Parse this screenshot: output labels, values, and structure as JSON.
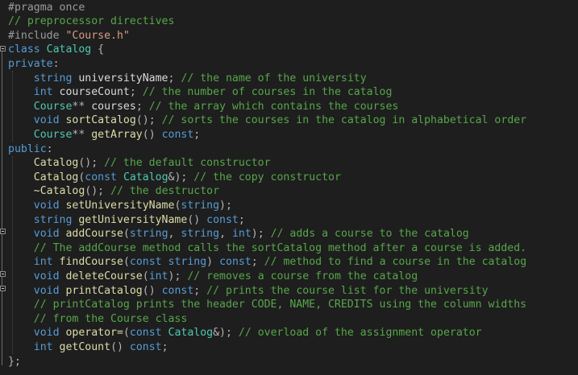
{
  "code": {
    "lines": [
      [
        [
          "pp",
          "#pragma once"
        ]
      ],
      [
        [
          "cm",
          "// preprocessor directives"
        ]
      ],
      [
        [
          "pp",
          "#include "
        ],
        [
          "str",
          "\"Course.h\""
        ]
      ],
      [
        [
          "kw",
          "class "
        ],
        [
          "typ",
          "Catalog"
        ],
        [
          "p",
          " {"
        ]
      ],
      [
        [
          "kw",
          "private"
        ],
        [
          "p",
          ":"
        ]
      ],
      [
        [
          "p",
          "    "
        ],
        [
          "kw",
          "string "
        ],
        [
          "var",
          "universityName"
        ],
        [
          "p",
          "; "
        ],
        [
          "cm",
          "// the name of the university"
        ]
      ],
      [
        [
          "p",
          "    "
        ],
        [
          "kw",
          "int "
        ],
        [
          "var",
          "courseCount"
        ],
        [
          "p",
          "; "
        ],
        [
          "cm",
          "// the number of courses in the catalog"
        ]
      ],
      [
        [
          "p",
          "    "
        ],
        [
          "typ",
          "Course"
        ],
        [
          "p",
          "** "
        ],
        [
          "var",
          "courses"
        ],
        [
          "p",
          "; "
        ],
        [
          "cm",
          "// the array which contains the courses"
        ]
      ],
      [
        [
          "p",
          "    "
        ],
        [
          "kw",
          "void "
        ],
        [
          "fn",
          "sortCatalog"
        ],
        [
          "p",
          "(); "
        ],
        [
          "cm",
          "// sorts the courses in the catalog in alphabetical order"
        ]
      ],
      [
        [
          "p",
          "    "
        ],
        [
          "typ",
          "Course"
        ],
        [
          "p",
          "** "
        ],
        [
          "fn",
          "getArray"
        ],
        [
          "p",
          "() "
        ],
        [
          "kw",
          "const"
        ],
        [
          "p",
          ";"
        ]
      ],
      [
        [
          "kw",
          "public"
        ],
        [
          "p",
          ":"
        ]
      ],
      [
        [
          "p",
          "    "
        ],
        [
          "fn",
          "Catalog"
        ],
        [
          "p",
          "(); "
        ],
        [
          "cm",
          "// the default constructor"
        ]
      ],
      [
        [
          "p",
          "    "
        ],
        [
          "fn",
          "Catalog"
        ],
        [
          "p",
          "("
        ],
        [
          "kw",
          "const "
        ],
        [
          "typ",
          "Catalog"
        ],
        [
          "p",
          "&); "
        ],
        [
          "cm",
          "// the copy constructor"
        ]
      ],
      [
        [
          "p",
          "    "
        ],
        [
          "fn",
          "~Catalog"
        ],
        [
          "p",
          "(); "
        ],
        [
          "cm",
          "// the destructor"
        ]
      ],
      [
        [
          "p",
          "    "
        ],
        [
          "kw",
          "void "
        ],
        [
          "fn",
          "setUniversityName"
        ],
        [
          "p",
          "("
        ],
        [
          "kw",
          "string"
        ],
        [
          "p",
          ");"
        ]
      ],
      [
        [
          "p",
          "    "
        ],
        [
          "kw",
          "string "
        ],
        [
          "fn",
          "getUniversityName"
        ],
        [
          "p",
          "() "
        ],
        [
          "kw",
          "const"
        ],
        [
          "p",
          ";"
        ]
      ],
      [
        [
          "p",
          "    "
        ],
        [
          "kw",
          "void "
        ],
        [
          "fn",
          "addCourse"
        ],
        [
          "p",
          "("
        ],
        [
          "kw",
          "string"
        ],
        [
          "p",
          ", "
        ],
        [
          "kw",
          "string"
        ],
        [
          "p",
          ", "
        ],
        [
          "kw",
          "int"
        ],
        [
          "p",
          "); "
        ],
        [
          "cm",
          "// adds a course to the catalog"
        ]
      ],
      [
        [
          "p",
          "    "
        ],
        [
          "cm",
          "// The addCourse method calls the sortCatalog method after a course is added."
        ]
      ],
      [
        [
          "p",
          "    "
        ],
        [
          "kw",
          "int "
        ],
        [
          "fn",
          "findCourse"
        ],
        [
          "p",
          "("
        ],
        [
          "kw",
          "const string"
        ],
        [
          "p",
          ") "
        ],
        [
          "kw",
          "const"
        ],
        [
          "p",
          "; "
        ],
        [
          "cm",
          "// method to find a course in the catalog"
        ]
      ],
      [
        [
          "p",
          "    "
        ],
        [
          "kw",
          "void "
        ],
        [
          "fn",
          "deleteCourse"
        ],
        [
          "p",
          "("
        ],
        [
          "kw",
          "int"
        ],
        [
          "p",
          "); "
        ],
        [
          "cm",
          "// removes a course from the catalog"
        ]
      ],
      [
        [
          "p",
          "    "
        ],
        [
          "kw",
          "void "
        ],
        [
          "fn",
          "printCatalog"
        ],
        [
          "p",
          "() "
        ],
        [
          "kw",
          "const"
        ],
        [
          "p",
          "; "
        ],
        [
          "cm",
          "// prints the course list for the university"
        ]
      ],
      [
        [
          "p",
          "    "
        ],
        [
          "cm",
          "// printCatalog prints the header CODE, NAME, CREDITS using the column widths"
        ]
      ],
      [
        [
          "p",
          "    "
        ],
        [
          "cm",
          "// from the Course class"
        ]
      ],
      [
        [
          "p",
          "    "
        ],
        [
          "kw",
          "void "
        ],
        [
          "fn",
          "operator="
        ],
        [
          "p",
          "("
        ],
        [
          "kw",
          "const "
        ],
        [
          "typ",
          "Catalog"
        ],
        [
          "p",
          "&); "
        ],
        [
          "cm",
          "// overload of the assignment operator"
        ]
      ],
      [
        [
          "p",
          "    "
        ],
        [
          "kw",
          "int "
        ],
        [
          "fn",
          "getCount"
        ],
        [
          "p",
          "() "
        ],
        [
          "kw",
          "const"
        ],
        [
          "p",
          ";"
        ]
      ],
      [
        [
          "p",
          "};"
        ]
      ]
    ]
  }
}
